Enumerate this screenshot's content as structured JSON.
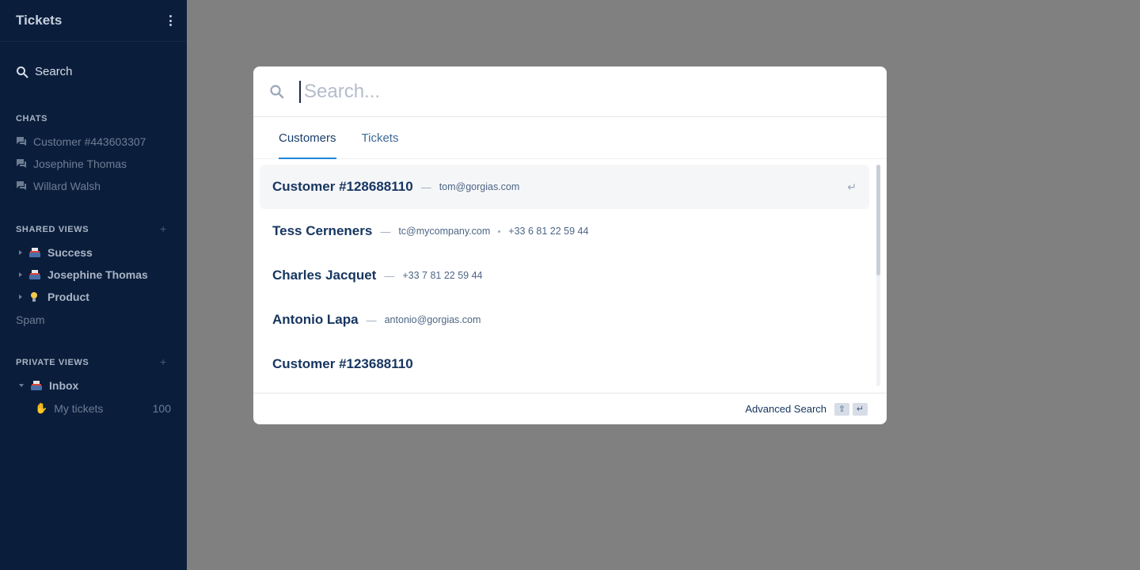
{
  "sidebar": {
    "title": "Tickets",
    "search_label": "Search",
    "chats": {
      "title": "CHATS",
      "items": [
        {
          "label": "Customer #443603307"
        },
        {
          "label": "Josephine Thomas"
        },
        {
          "label": "Willard Walsh"
        }
      ]
    },
    "shared_views": {
      "title": "SHARED VIEWS",
      "add_symbol": "+",
      "items": [
        {
          "label": "Success",
          "icon": "inbox-icon"
        },
        {
          "label": "Josephine Thomas",
          "icon": "inbox-icon"
        },
        {
          "label": "Product",
          "icon": "lightbulb-icon"
        }
      ]
    },
    "spam_label": "Spam",
    "private_views": {
      "title": "PRIVATE VIEWS",
      "add_symbol": "+",
      "inbox_label": "Inbox",
      "my_tickets_label": "My tickets",
      "my_tickets_count": "100"
    }
  },
  "modal": {
    "search": {
      "placeholder": "Search...",
      "value": ""
    },
    "tabs": [
      {
        "label": "Customers",
        "active": true
      },
      {
        "label": "Tickets",
        "active": false
      }
    ],
    "results": [
      {
        "name": "Customer #128688110",
        "email": "tom@gorgias.com",
        "phone": "",
        "selected": true
      },
      {
        "name": "Tess Cerneners",
        "email": "tc@mycompany.com",
        "phone": "+33 6 81 22 59 44",
        "selected": false
      },
      {
        "name": "Charles Jacquet",
        "email": "",
        "phone": "+33 7 81 22 59 44",
        "selected": false
      },
      {
        "name": "Antonio Lapa",
        "email": "antonio@gorgias.com",
        "phone": "",
        "selected": false
      },
      {
        "name": "Customer #123688110",
        "email": "",
        "phone": "",
        "selected": false
      }
    ],
    "result_separator": "—",
    "enter_symbol": "↵",
    "footer": {
      "advanced_search_label": "Advanced Search",
      "shift_key": "⇧",
      "enter_key": "↵"
    }
  },
  "colors": {
    "sidebar_bg": "#0a1e3c",
    "overlay_bg": "#808080",
    "accent": "#1f86d8",
    "text_primary": "#173660"
  }
}
